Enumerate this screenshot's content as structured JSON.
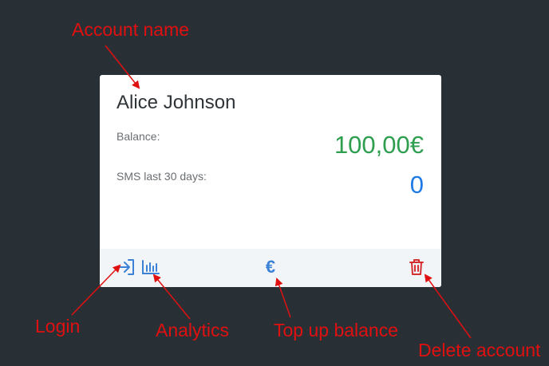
{
  "account": {
    "name": "Alice Johnson",
    "balance_label": "Balance:",
    "balance_value": "100,00€",
    "sms_label": "SMS last 30 days:",
    "sms_value": "0"
  },
  "footer": {
    "login_icon": "login-icon",
    "analytics_icon": "bar-chart-icon",
    "topup_glyph": "€",
    "delete_icon": "trash-icon"
  },
  "annotations": {
    "account_name": "Account name",
    "login": "Login",
    "analytics": "Analytics",
    "top_up": "Top up balance",
    "delete": "Delete account"
  },
  "colors": {
    "background": "#283036",
    "card": "#ffffff",
    "footer": "#f2f5f8",
    "balance": "#2e9e4f",
    "sms": "#1e7be6",
    "icon_blue": "#3b82d6",
    "delete": "#d32f2f",
    "annotation": "#e01010"
  }
}
